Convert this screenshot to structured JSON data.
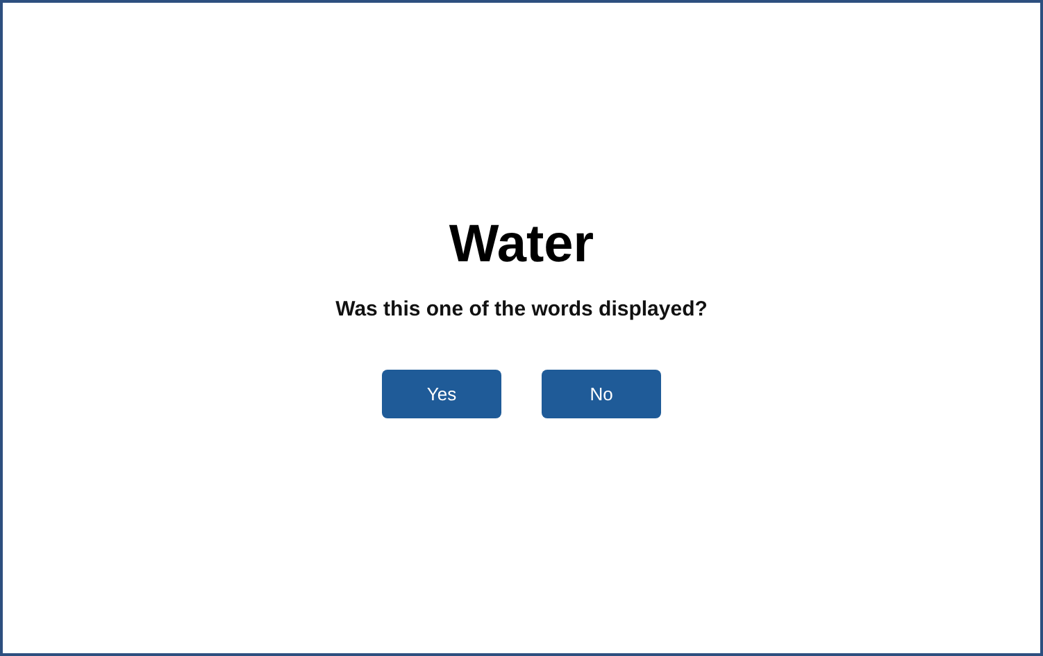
{
  "word": "Water",
  "question": "Was this one of the words displayed?",
  "buttons": [
    "Yes",
    "No"
  ]
}
